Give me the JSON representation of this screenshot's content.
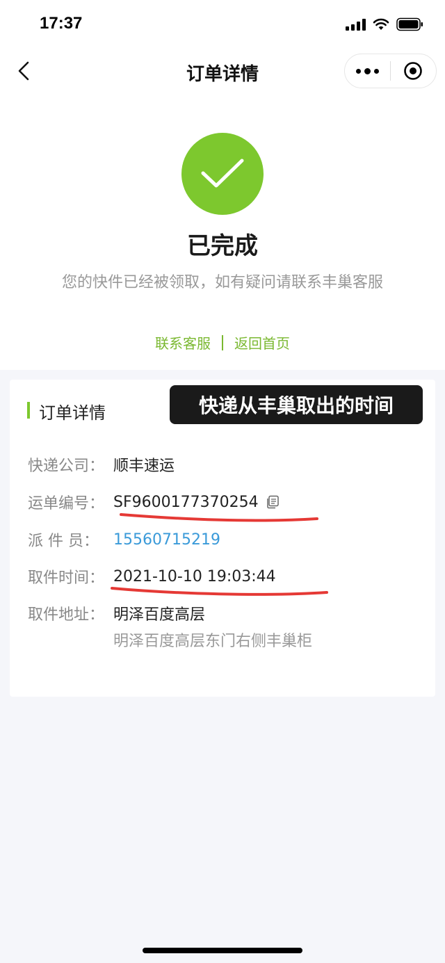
{
  "status_bar": {
    "time": "17:37"
  },
  "nav": {
    "title": "订单详情"
  },
  "status": {
    "title": "已完成",
    "description": "您的快件已经被领取，如有疑问请联系丰巢客服"
  },
  "links": {
    "contact_service": "联系客服",
    "back_home": "返回首页"
  },
  "card": {
    "section_title": "订单详情",
    "annotation": "快递从丰巢取出的时间",
    "fields": {
      "company_label": "快递公司：",
      "company_value": "顺丰速运",
      "tracking_label": "运单编号：",
      "tracking_value": "SF9600177370254",
      "courier_label": "派 件 员：",
      "courier_phone": "15560715219",
      "pickup_time_label": "取件时间：",
      "pickup_time_value": "2021-10-10 19:03:44",
      "pickup_address_label": "取件地址：",
      "pickup_address_value": "明泽百度高层",
      "pickup_address_detail": "明泽百度高层东门右侧丰巢柜"
    }
  },
  "colors": {
    "accent_green": "#7dc82e",
    "link_blue": "#3a9ad9",
    "annotation_red": "#e53935"
  },
  "icons": [
    "cellular-signal-icon",
    "wifi-icon",
    "battery-icon",
    "back-arrow-icon",
    "more-dots-icon",
    "target-circle-icon",
    "check-icon",
    "copy-icon"
  ]
}
